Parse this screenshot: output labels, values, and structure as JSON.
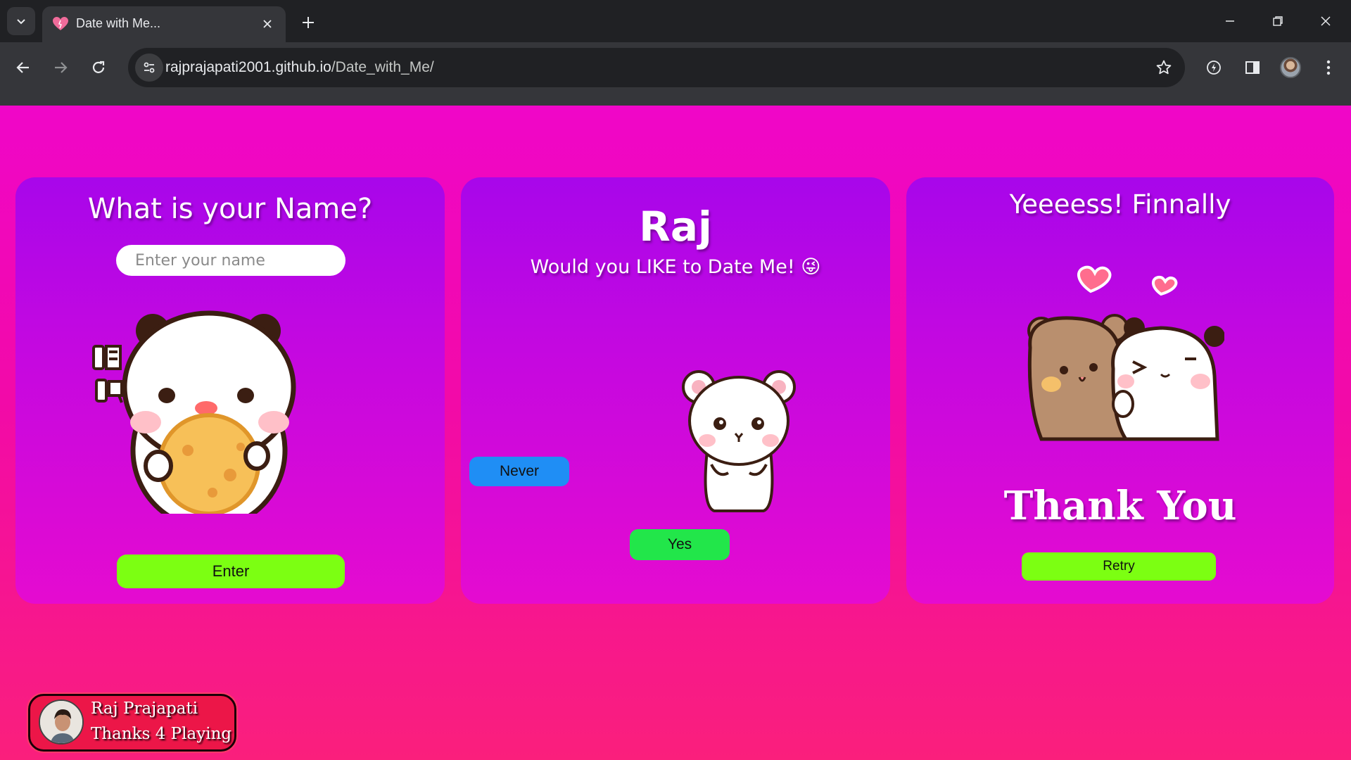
{
  "browser": {
    "tab_title": "Date with Me...",
    "url_host": "rajprajapati2001.github.io",
    "url_path": "/Date_with_Me/"
  },
  "card1": {
    "title": "What is your Name?",
    "name_placeholder": "Enter your name",
    "enter_label": "Enter"
  },
  "card2": {
    "name": "Raj",
    "question": "Would you LIKE to Date Me! 😜",
    "never_label": "Never",
    "yes_label": "Yes"
  },
  "card3": {
    "title": "Yeeeess! Finnally",
    "thanks": "Thank You",
    "retry_label": "Retry"
  },
  "credit": {
    "name": "Raj Prajapati",
    "message": "Thanks 4 Playing"
  },
  "colors": {
    "page_top": "#f006c8",
    "page_bottom": "#fa1f7c",
    "card": "#c408e0",
    "enter_button": "#7cff12",
    "never_button": "#1f8ef5",
    "yes_button": "#22e64a"
  }
}
